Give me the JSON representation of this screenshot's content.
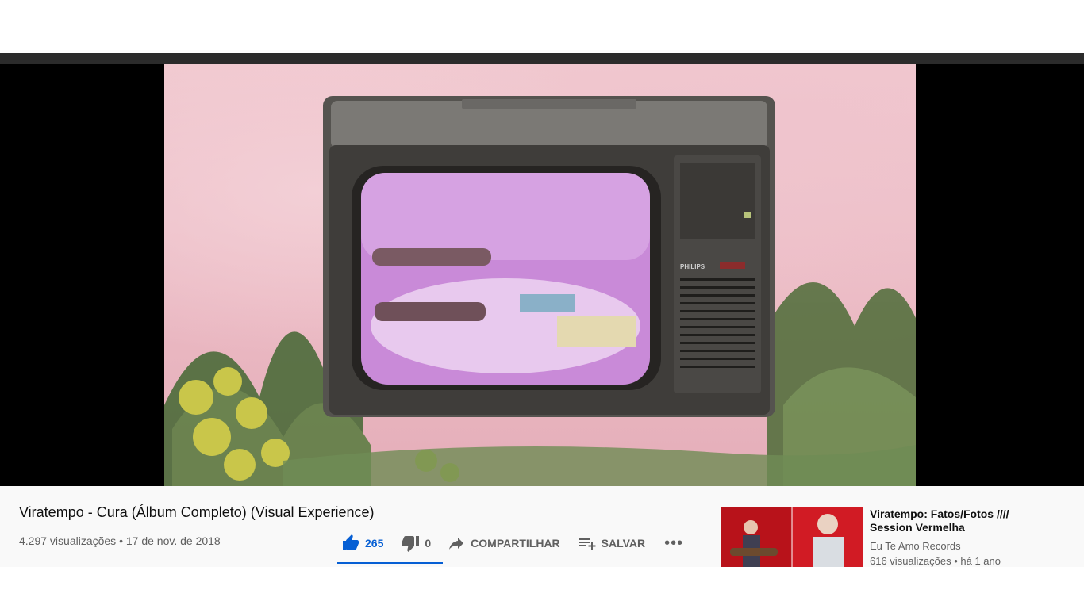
{
  "video": {
    "title": "Viratempo - Cura (Álbum Completo) (Visual Experience)",
    "views": "4.297 visualizações",
    "separator": "•",
    "date": "17 de nov. de 2018"
  },
  "actions": {
    "like_count": "265",
    "dislike_count": "0",
    "share_label": "COMPARTILHAR",
    "save_label": "SALVAR",
    "more_label": "•••"
  },
  "recommendation": {
    "title": "Viratempo: Fatos/Fotos //// Session Vermelha",
    "channel": "Eu Te Amo Records",
    "meta": "616 visualizações • há 1 ano"
  },
  "video_frame": {
    "brand": "PHILIPS"
  },
  "colors": {
    "accent": "#065fd4",
    "text_primary": "#0f0f0f",
    "text_secondary": "#606060"
  }
}
